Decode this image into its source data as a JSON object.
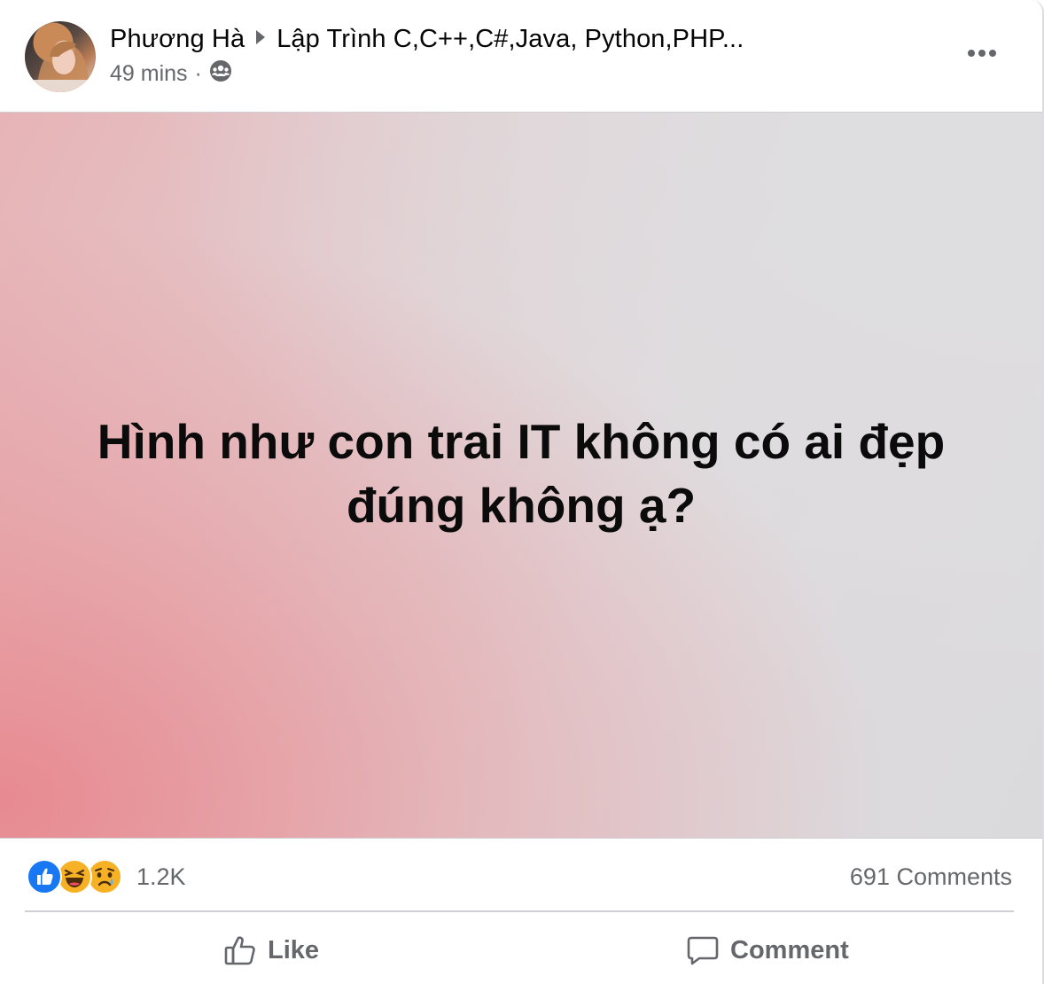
{
  "post": {
    "author": "Phương Hà",
    "group": "Lập Trình C,C++,C#,Java, Python,PHP...",
    "time": "49 mins",
    "separator": "·",
    "audience_icon": "group-icon",
    "text_lines": [
      "Hình như con trai IT không có ai đẹp",
      "đúng không ạ?"
    ],
    "background_colors": {
      "pink": "#e7b3b6",
      "grey": "#dadadd"
    }
  },
  "reactions": {
    "icons": [
      "like-reaction-icon",
      "haha-reaction-icon",
      "sad-reaction-icon"
    ],
    "count": "1.2K"
  },
  "comments": {
    "count_label": "691 Comments"
  },
  "actions": {
    "like_label": "Like",
    "comment_label": "Comment"
  },
  "colors": {
    "like_blue": "#1877f2",
    "emoji_yellow": "#f7b125",
    "secondary_text": "#65676b"
  }
}
